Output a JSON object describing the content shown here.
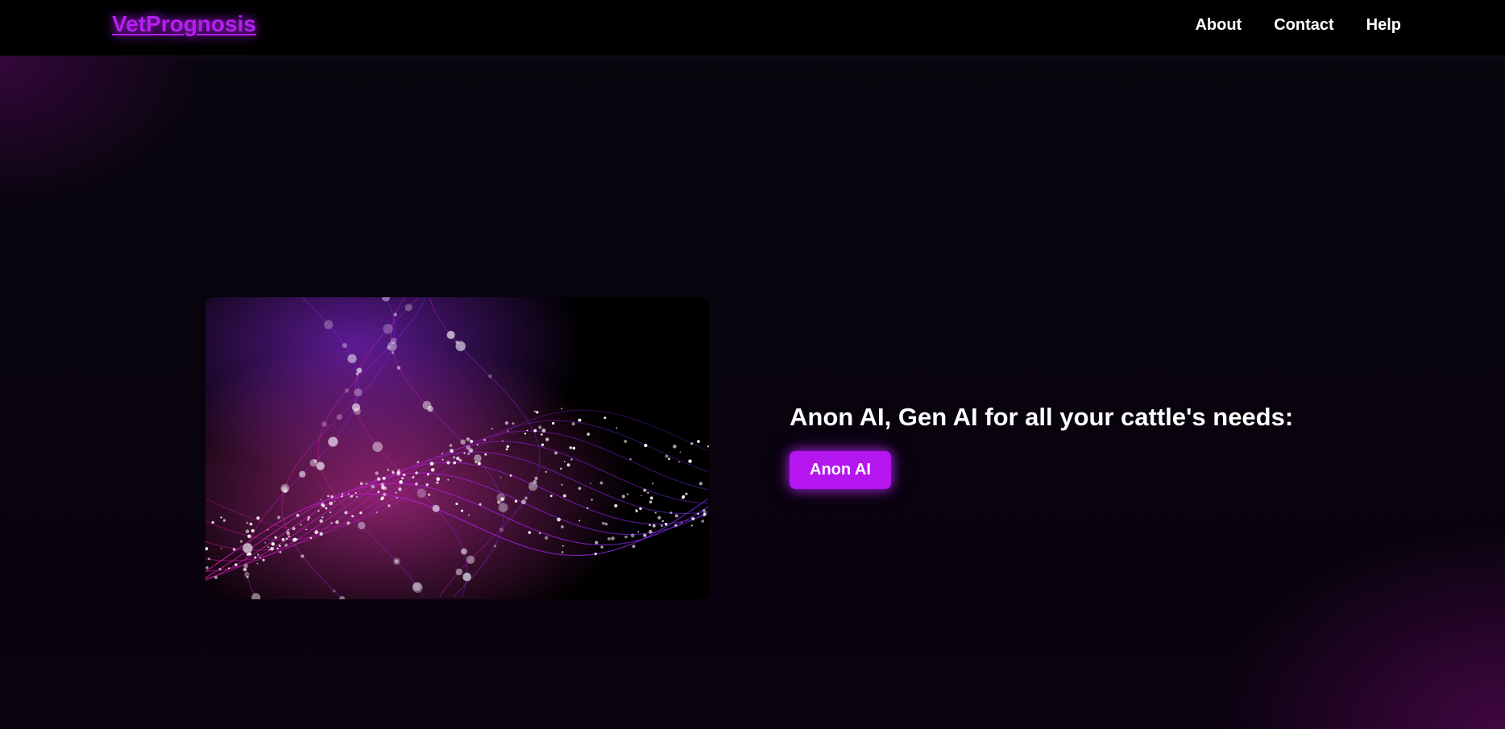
{
  "header": {
    "brand": "VetPrognosis",
    "nav": [
      {
        "label": "About"
      },
      {
        "label": "Contact"
      },
      {
        "label": "Help"
      }
    ]
  },
  "hero": {
    "headline": "Anon AI, Gen AI for all your cattle's needs:",
    "cta_label": "Anon AI",
    "image_icon": "neural-mesh-wave-image"
  },
  "colors": {
    "accent": "#b516f0",
    "brand": "#b41ff0",
    "header_bg": "#000000",
    "page_bg": "#08030d"
  }
}
